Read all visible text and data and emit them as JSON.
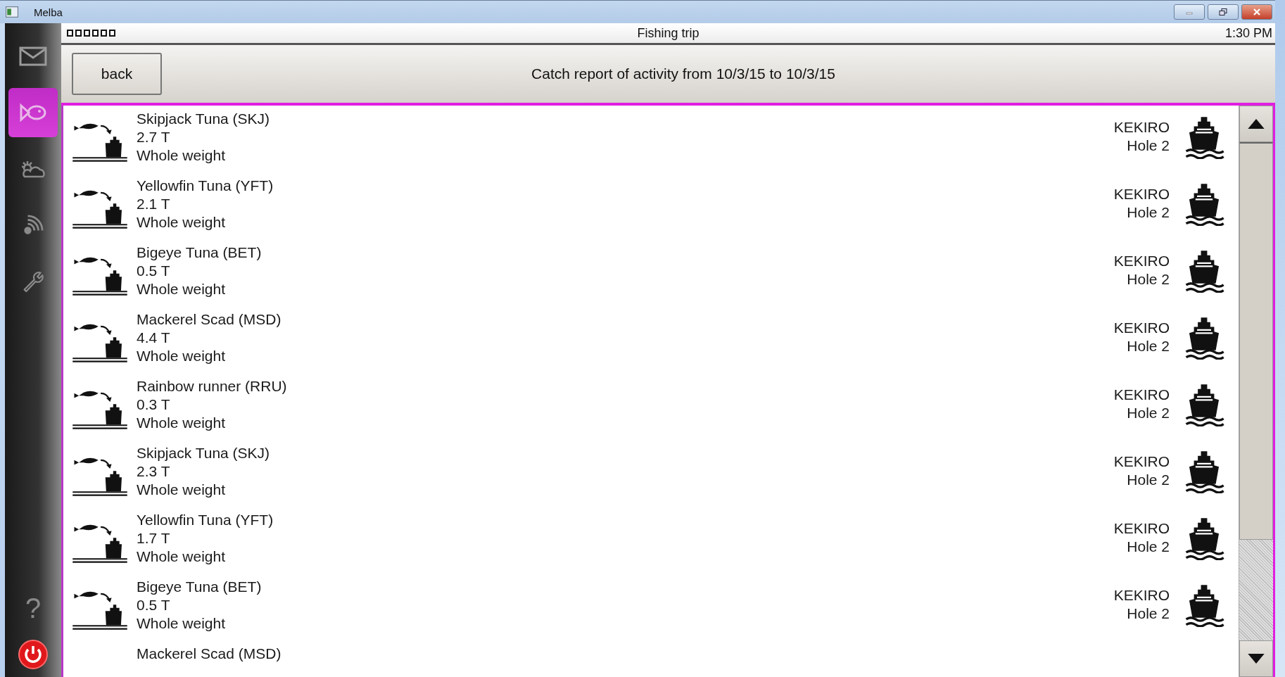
{
  "window": {
    "title": "Melba"
  },
  "sidebar": {
    "items": [
      {
        "kind": "mail",
        "selected": false
      },
      {
        "kind": "fish",
        "selected": true
      },
      {
        "kind": "weather",
        "selected": false
      },
      {
        "kind": "signal",
        "selected": false
      },
      {
        "kind": "wrench",
        "selected": false
      }
    ],
    "help": "?"
  },
  "status_bar": {
    "title": "Fishing trip",
    "time": "1:30 PM"
  },
  "header": {
    "back": "back",
    "title": "Catch report of activity from 10/3/15 to 10/3/15"
  },
  "catches": [
    {
      "species": "Skipjack Tuna (SKJ)",
      "weight": "2.7 T",
      "form": "Whole weight",
      "vessel": "KEKIRO",
      "hold": "Hole 2"
    },
    {
      "species": "Yellowfin Tuna (YFT)",
      "weight": "2.1 T",
      "form": "Whole weight",
      "vessel": "KEKIRO",
      "hold": "Hole 2"
    },
    {
      "species": "Bigeye Tuna (BET)",
      "weight": "0.5 T",
      "form": "Whole weight",
      "vessel": "KEKIRO",
      "hold": "Hole 2"
    },
    {
      "species": "Mackerel Scad (MSD)",
      "weight": "4.4 T",
      "form": "Whole weight",
      "vessel": "KEKIRO",
      "hold": "Hole 2"
    },
    {
      "species": "Rainbow runner (RRU)",
      "weight": "0.3 T",
      "form": "Whole weight",
      "vessel": "KEKIRO",
      "hold": "Hole 2"
    },
    {
      "species": "Skipjack Tuna (SKJ)",
      "weight": "2.3 T",
      "form": "Whole weight",
      "vessel": "KEKIRO",
      "hold": "Hole 2"
    },
    {
      "species": "Yellowfin Tuna (YFT)",
      "weight": "1.7 T",
      "form": "Whole weight",
      "vessel": "KEKIRO",
      "hold": "Hole 2"
    },
    {
      "species": "Bigeye Tuna (BET)",
      "weight": "0.5 T",
      "form": "Whole weight",
      "vessel": "KEKIRO",
      "hold": "Hole 2"
    },
    {
      "species": "Mackerel Scad (MSD)"
    }
  ]
}
